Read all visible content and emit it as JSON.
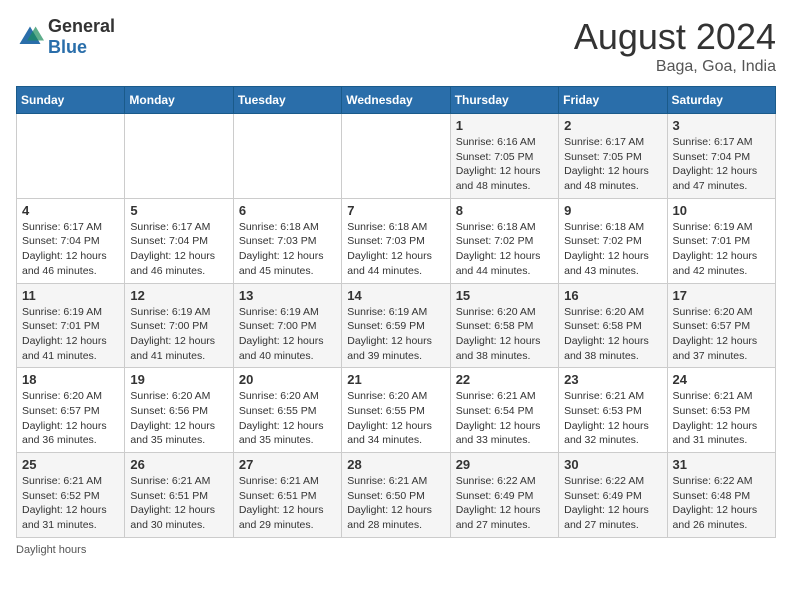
{
  "header": {
    "logo_general": "General",
    "logo_blue": "Blue",
    "month_year": "August 2024",
    "location": "Baga, Goa, India"
  },
  "footer": {
    "daylight_label": "Daylight hours"
  },
  "weekdays": [
    "Sunday",
    "Monday",
    "Tuesday",
    "Wednesday",
    "Thursday",
    "Friday",
    "Saturday"
  ],
  "weeks": [
    [
      {
        "day": "",
        "sunrise": "",
        "sunset": "",
        "daylight": ""
      },
      {
        "day": "",
        "sunrise": "",
        "sunset": "",
        "daylight": ""
      },
      {
        "day": "",
        "sunrise": "",
        "sunset": "",
        "daylight": ""
      },
      {
        "day": "",
        "sunrise": "",
        "sunset": "",
        "daylight": ""
      },
      {
        "day": "1",
        "sunrise": "Sunrise: 6:16 AM",
        "sunset": "Sunset: 7:05 PM",
        "daylight": "Daylight: 12 hours and 48 minutes."
      },
      {
        "day": "2",
        "sunrise": "Sunrise: 6:17 AM",
        "sunset": "Sunset: 7:05 PM",
        "daylight": "Daylight: 12 hours and 48 minutes."
      },
      {
        "day": "3",
        "sunrise": "Sunrise: 6:17 AM",
        "sunset": "Sunset: 7:04 PM",
        "daylight": "Daylight: 12 hours and 47 minutes."
      }
    ],
    [
      {
        "day": "4",
        "sunrise": "Sunrise: 6:17 AM",
        "sunset": "Sunset: 7:04 PM",
        "daylight": "Daylight: 12 hours and 46 minutes."
      },
      {
        "day": "5",
        "sunrise": "Sunrise: 6:17 AM",
        "sunset": "Sunset: 7:04 PM",
        "daylight": "Daylight: 12 hours and 46 minutes."
      },
      {
        "day": "6",
        "sunrise": "Sunrise: 6:18 AM",
        "sunset": "Sunset: 7:03 PM",
        "daylight": "Daylight: 12 hours and 45 minutes."
      },
      {
        "day": "7",
        "sunrise": "Sunrise: 6:18 AM",
        "sunset": "Sunset: 7:03 PM",
        "daylight": "Daylight: 12 hours and 44 minutes."
      },
      {
        "day": "8",
        "sunrise": "Sunrise: 6:18 AM",
        "sunset": "Sunset: 7:02 PM",
        "daylight": "Daylight: 12 hours and 44 minutes."
      },
      {
        "day": "9",
        "sunrise": "Sunrise: 6:18 AM",
        "sunset": "Sunset: 7:02 PM",
        "daylight": "Daylight: 12 hours and 43 minutes."
      },
      {
        "day": "10",
        "sunrise": "Sunrise: 6:19 AM",
        "sunset": "Sunset: 7:01 PM",
        "daylight": "Daylight: 12 hours and 42 minutes."
      }
    ],
    [
      {
        "day": "11",
        "sunrise": "Sunrise: 6:19 AM",
        "sunset": "Sunset: 7:01 PM",
        "daylight": "Daylight: 12 hours and 41 minutes."
      },
      {
        "day": "12",
        "sunrise": "Sunrise: 6:19 AM",
        "sunset": "Sunset: 7:00 PM",
        "daylight": "Daylight: 12 hours and 41 minutes."
      },
      {
        "day": "13",
        "sunrise": "Sunrise: 6:19 AM",
        "sunset": "Sunset: 7:00 PM",
        "daylight": "Daylight: 12 hours and 40 minutes."
      },
      {
        "day": "14",
        "sunrise": "Sunrise: 6:19 AM",
        "sunset": "Sunset: 6:59 PM",
        "daylight": "Daylight: 12 hours and 39 minutes."
      },
      {
        "day": "15",
        "sunrise": "Sunrise: 6:20 AM",
        "sunset": "Sunset: 6:58 PM",
        "daylight": "Daylight: 12 hours and 38 minutes."
      },
      {
        "day": "16",
        "sunrise": "Sunrise: 6:20 AM",
        "sunset": "Sunset: 6:58 PM",
        "daylight": "Daylight: 12 hours and 38 minutes."
      },
      {
        "day": "17",
        "sunrise": "Sunrise: 6:20 AM",
        "sunset": "Sunset: 6:57 PM",
        "daylight": "Daylight: 12 hours and 37 minutes."
      }
    ],
    [
      {
        "day": "18",
        "sunrise": "Sunrise: 6:20 AM",
        "sunset": "Sunset: 6:57 PM",
        "daylight": "Daylight: 12 hours and 36 minutes."
      },
      {
        "day": "19",
        "sunrise": "Sunrise: 6:20 AM",
        "sunset": "Sunset: 6:56 PM",
        "daylight": "Daylight: 12 hours and 35 minutes."
      },
      {
        "day": "20",
        "sunrise": "Sunrise: 6:20 AM",
        "sunset": "Sunset: 6:55 PM",
        "daylight": "Daylight: 12 hours and 35 minutes."
      },
      {
        "day": "21",
        "sunrise": "Sunrise: 6:20 AM",
        "sunset": "Sunset: 6:55 PM",
        "daylight": "Daylight: 12 hours and 34 minutes."
      },
      {
        "day": "22",
        "sunrise": "Sunrise: 6:21 AM",
        "sunset": "Sunset: 6:54 PM",
        "daylight": "Daylight: 12 hours and 33 minutes."
      },
      {
        "day": "23",
        "sunrise": "Sunrise: 6:21 AM",
        "sunset": "Sunset: 6:53 PM",
        "daylight": "Daylight: 12 hours and 32 minutes."
      },
      {
        "day": "24",
        "sunrise": "Sunrise: 6:21 AM",
        "sunset": "Sunset: 6:53 PM",
        "daylight": "Daylight: 12 hours and 31 minutes."
      }
    ],
    [
      {
        "day": "25",
        "sunrise": "Sunrise: 6:21 AM",
        "sunset": "Sunset: 6:52 PM",
        "daylight": "Daylight: 12 hours and 31 minutes."
      },
      {
        "day": "26",
        "sunrise": "Sunrise: 6:21 AM",
        "sunset": "Sunset: 6:51 PM",
        "daylight": "Daylight: 12 hours and 30 minutes."
      },
      {
        "day": "27",
        "sunrise": "Sunrise: 6:21 AM",
        "sunset": "Sunset: 6:51 PM",
        "daylight": "Daylight: 12 hours and 29 minutes."
      },
      {
        "day": "28",
        "sunrise": "Sunrise: 6:21 AM",
        "sunset": "Sunset: 6:50 PM",
        "daylight": "Daylight: 12 hours and 28 minutes."
      },
      {
        "day": "29",
        "sunrise": "Sunrise: 6:22 AM",
        "sunset": "Sunset: 6:49 PM",
        "daylight": "Daylight: 12 hours and 27 minutes."
      },
      {
        "day": "30",
        "sunrise": "Sunrise: 6:22 AM",
        "sunset": "Sunset: 6:49 PM",
        "daylight": "Daylight: 12 hours and 27 minutes."
      },
      {
        "day": "31",
        "sunrise": "Sunrise: 6:22 AM",
        "sunset": "Sunset: 6:48 PM",
        "daylight": "Daylight: 12 hours and 26 minutes."
      }
    ]
  ]
}
